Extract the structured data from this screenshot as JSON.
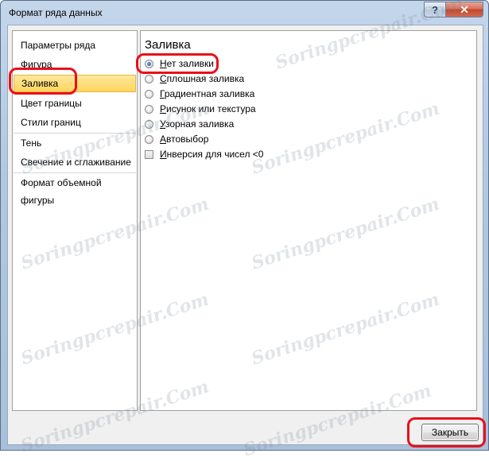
{
  "window": {
    "title": "Формат ряда данных",
    "help_glyph": "?",
    "close_glyph": "✕"
  },
  "sidebar": {
    "items": [
      {
        "label": "Параметры ряда"
      },
      {
        "label": "Фигура"
      },
      {
        "label": "Заливка",
        "selected": true
      },
      {
        "label": "Цвет границы"
      },
      {
        "label": "Стили границ"
      },
      {
        "label": "Тень"
      },
      {
        "label": "Свечение и сглаживание"
      },
      {
        "label": "Формат объемной фигуры"
      }
    ]
  },
  "main": {
    "section_title": "Заливка",
    "options": [
      {
        "label": "Нет заливки",
        "selected": true
      },
      {
        "label": "Сплошная заливка",
        "selected": false
      },
      {
        "label": "Градиентная заливка",
        "selected": false
      },
      {
        "label": "Рисунок или текстура",
        "selected": false
      },
      {
        "label": "Узорная заливка",
        "selected": false
      },
      {
        "label": "Автовыбор",
        "selected": false
      }
    ],
    "checkbox": {
      "label": "Инверсия для чисел <0",
      "checked": false
    }
  },
  "footer": {
    "close_label": "Закрыть"
  },
  "watermark": {
    "text": "Soringpcrepair.Com"
  },
  "colors": {
    "selection": "#ffd65e",
    "highlight_ring": "#e8101a",
    "close_button": "#c4462d"
  }
}
